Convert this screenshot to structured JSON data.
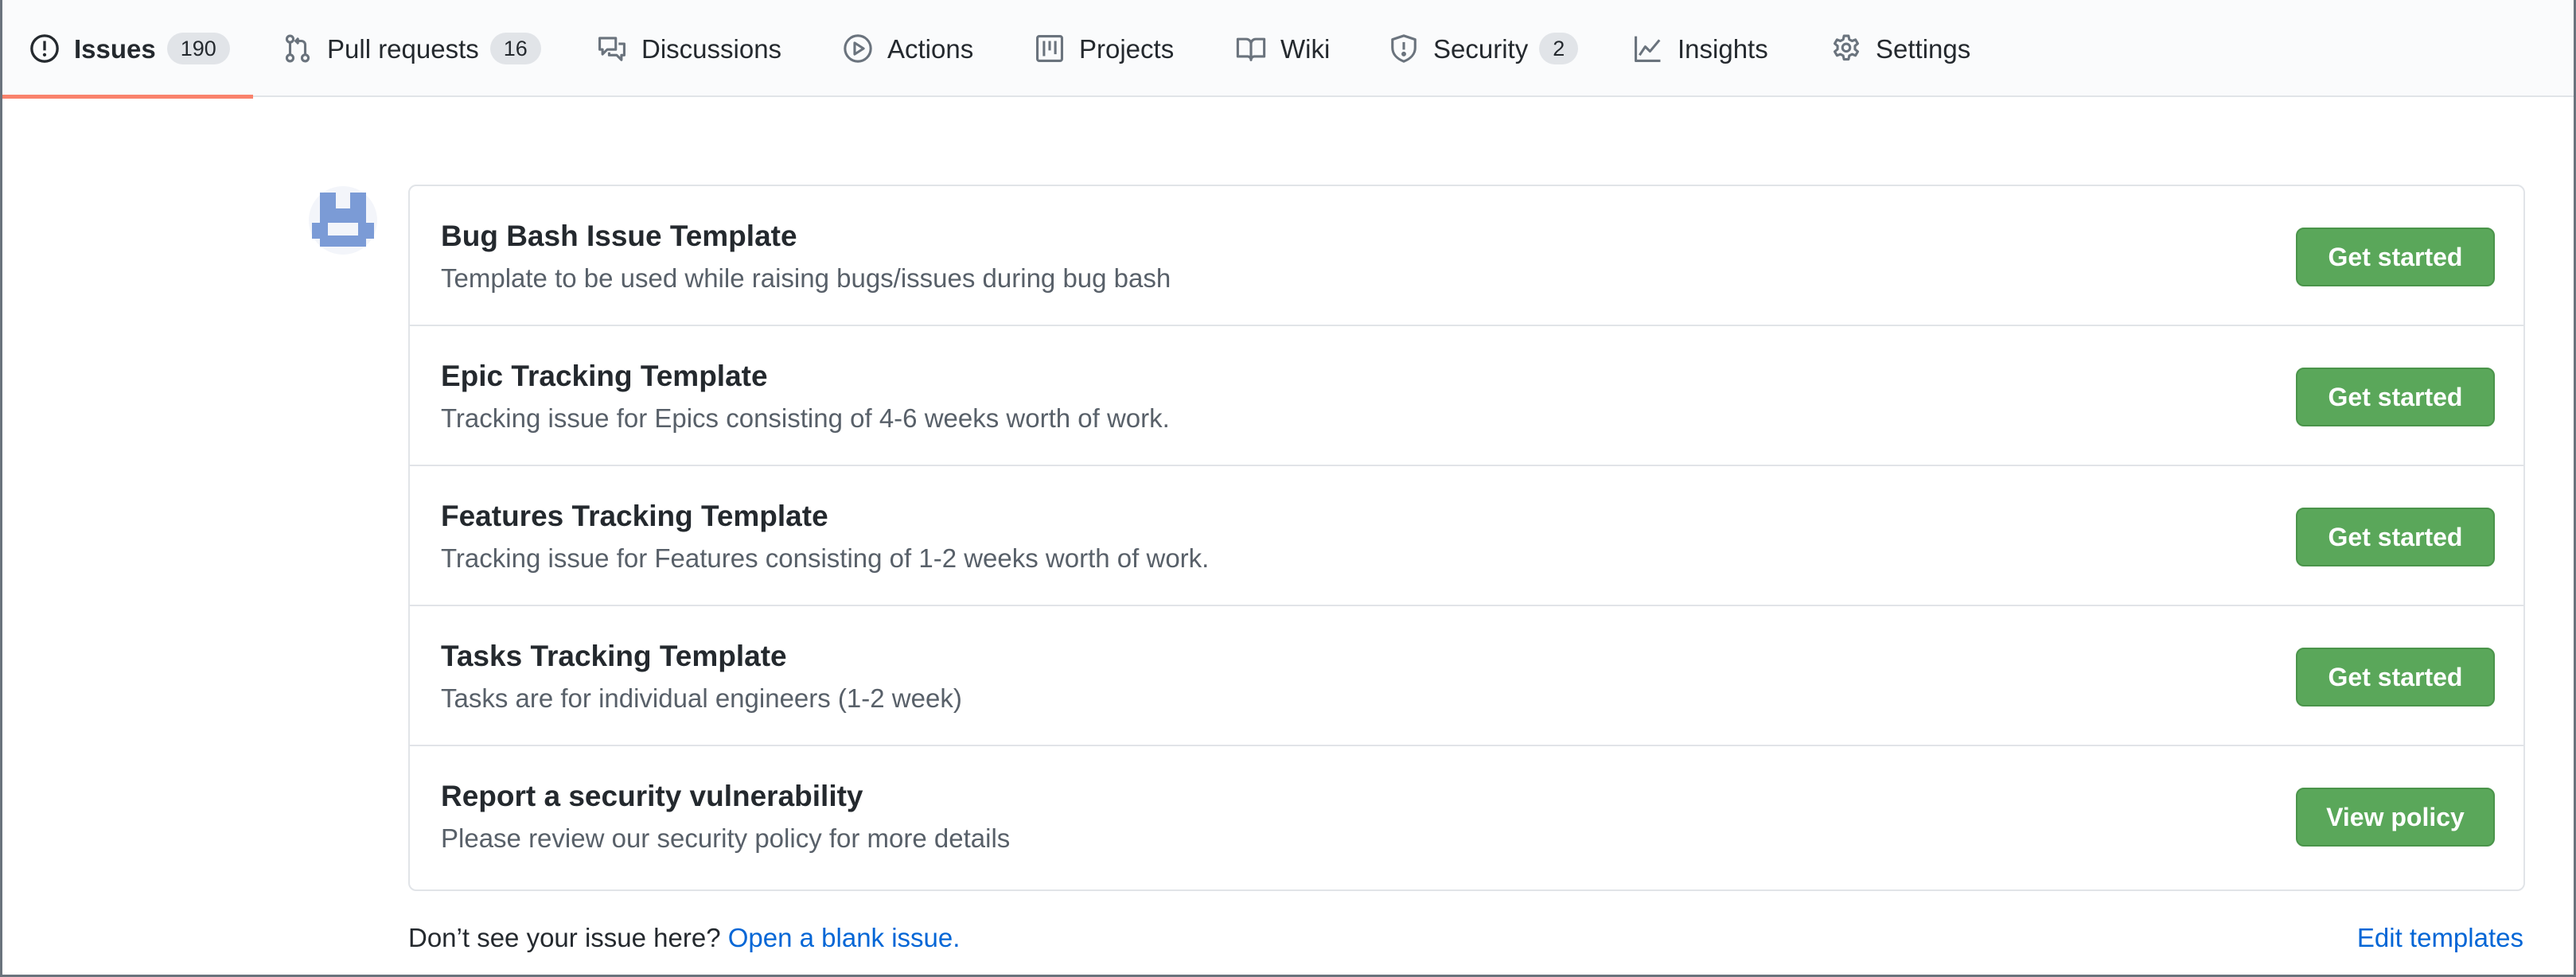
{
  "nav": {
    "tabs": [
      {
        "label": "Issues",
        "icon": "issue-opened-icon",
        "counter": "190",
        "selected": true
      },
      {
        "label": "Pull requests",
        "icon": "git-pull-request-icon",
        "counter": "16"
      },
      {
        "label": "Discussions",
        "icon": "comment-discussion-icon"
      },
      {
        "label": "Actions",
        "icon": "play-icon"
      },
      {
        "label": "Projects",
        "icon": "project-icon"
      },
      {
        "label": "Wiki",
        "icon": "book-icon"
      },
      {
        "label": "Security",
        "icon": "shield-icon",
        "counter": "2"
      },
      {
        "label": "Insights",
        "icon": "graph-icon"
      },
      {
        "label": "Settings",
        "icon": "gear-icon"
      }
    ],
    "selected_underline_color": "#f9826c"
  },
  "templates": [
    {
      "title": "Bug Bash Issue Template",
      "description": "Template to be used while raising bugs/issues during bug bash",
      "button": "Get started"
    },
    {
      "title": "Epic Tracking Template",
      "description": "Tracking issue for Epics consisting of 4-6 weeks worth of work.",
      "button": "Get started"
    },
    {
      "title": "Features Tracking Template",
      "description": "Tracking issue for Features consisting of 1-2 weeks worth of work.",
      "button": "Get started"
    },
    {
      "title": "Tasks Tracking Template",
      "description": "Tasks are for individual engineers (1-2 week)",
      "button": "Get started"
    },
    {
      "title": "Report a security vulnerability",
      "description": "Please review our security policy for more details",
      "button": "View policy"
    }
  ],
  "footer": {
    "prompt": "Don’t see your issue here?",
    "blank_issue_link": "Open a blank issue.",
    "edit_templates_link": "Edit templates"
  },
  "colors": {
    "button_green": "#5aa75a",
    "link_blue": "#0366d6",
    "avatar_blue": "#7b9bd6"
  }
}
